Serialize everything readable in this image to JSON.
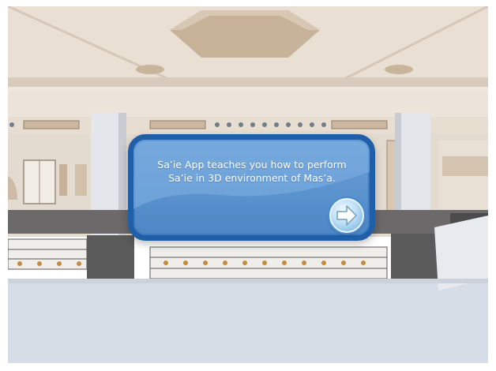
{
  "dialog": {
    "message": "Sa’ie App teaches you how to perform Sa’ie in 3D environment of Mas’a."
  },
  "controls": {
    "next_icon": "arrow-right-icon"
  },
  "colors": {
    "dialog_fill": "#5b93cf",
    "dialog_border": "#1f5fa8",
    "floor": "#d9dfe8",
    "ceiling": "#e8ddd0"
  }
}
